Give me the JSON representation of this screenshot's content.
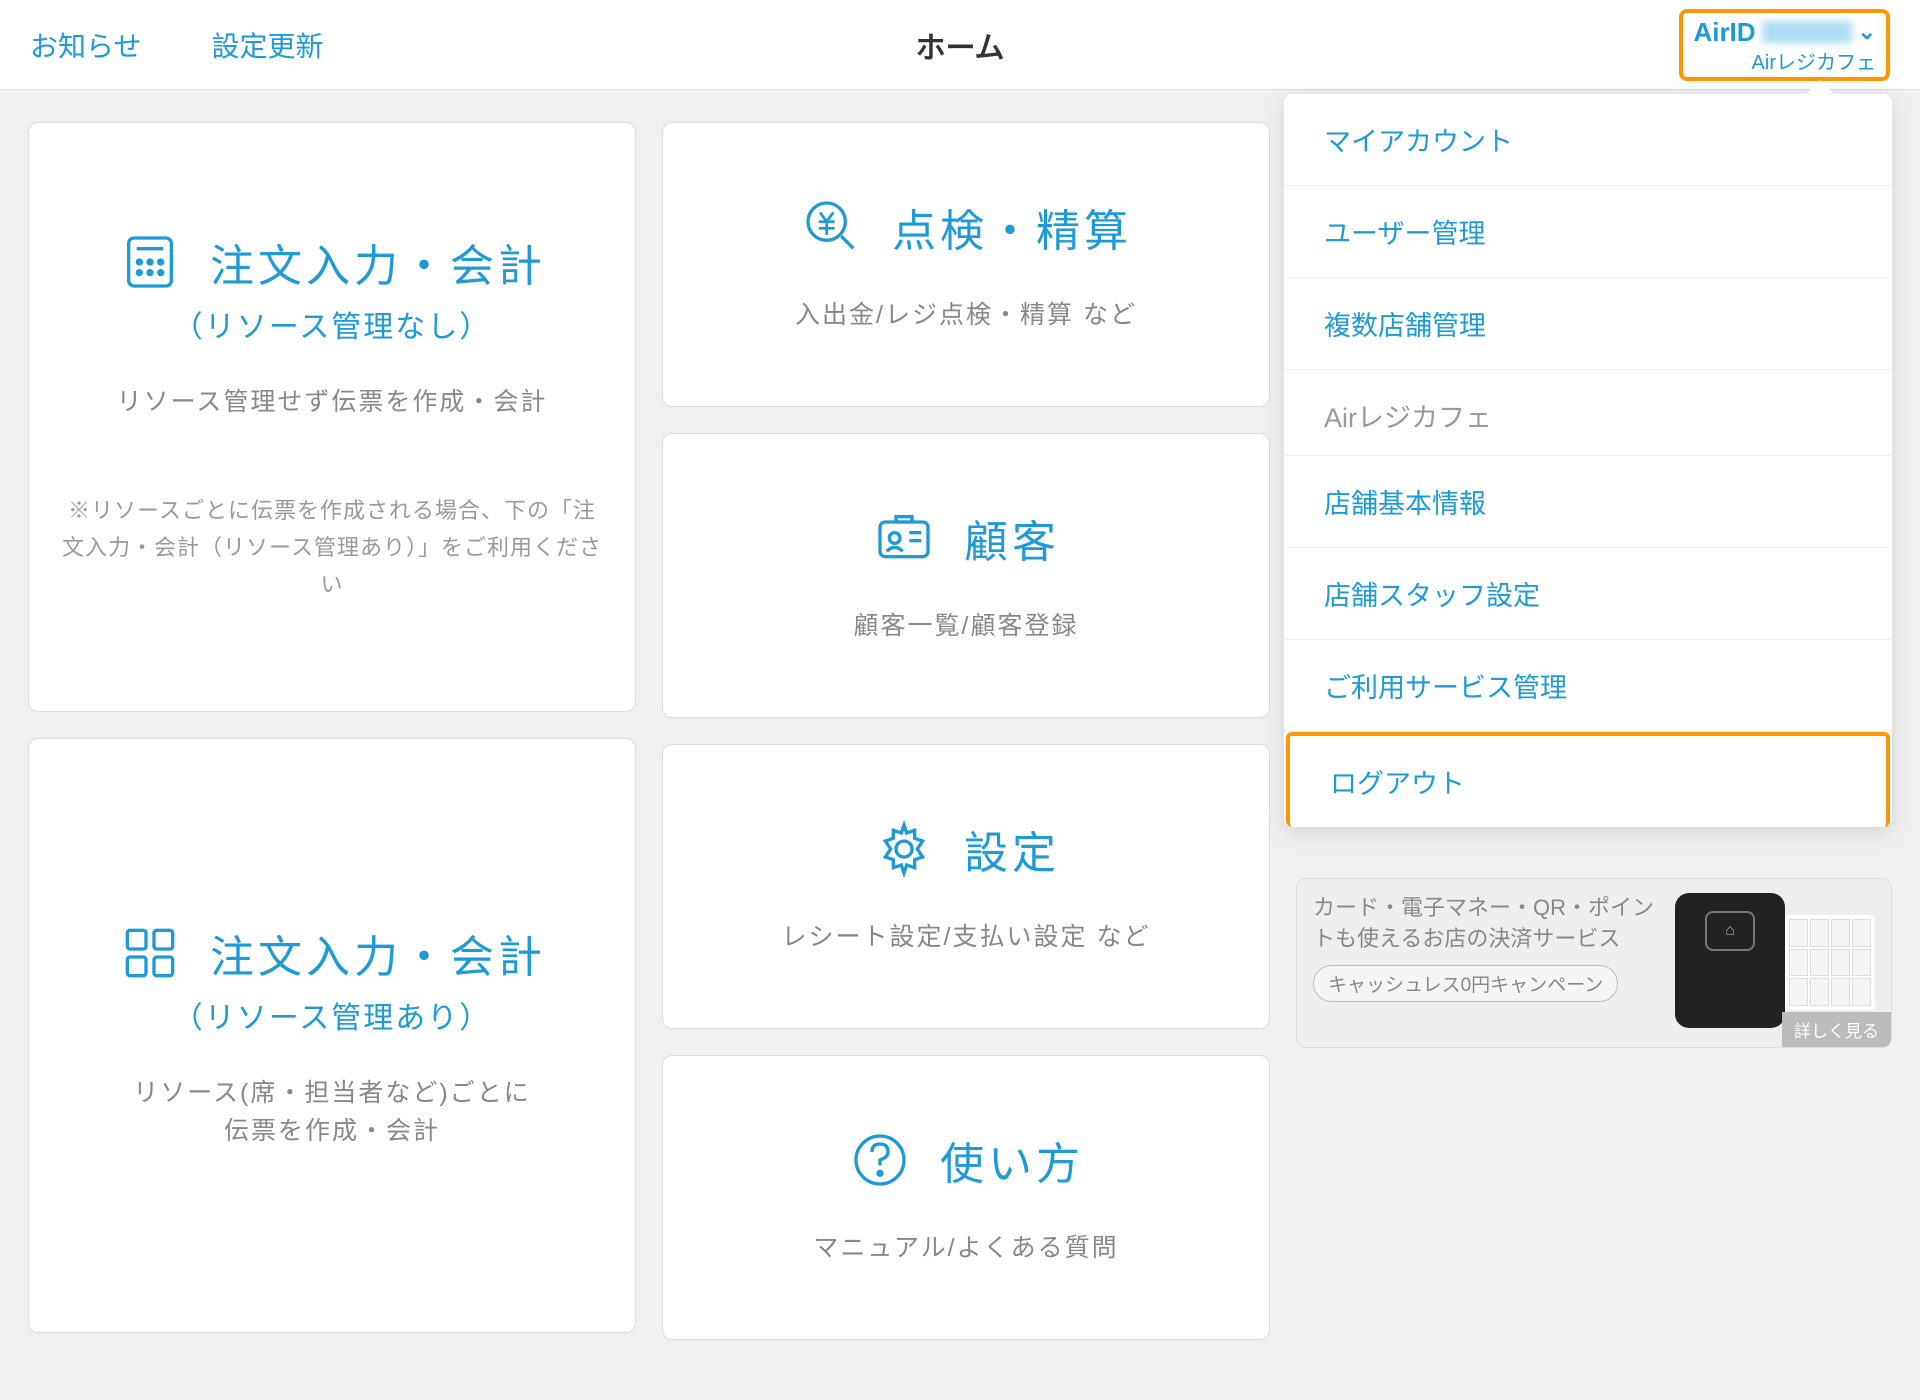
{
  "header": {
    "notice": "お知らせ",
    "settings_update": "設定更新",
    "title": "ホーム",
    "airid_label": "AirID",
    "store_sub": "Airレジカフェ"
  },
  "cards": {
    "order_noresource": {
      "title": "注文入力・会計",
      "subtitle": "（リソース管理なし）",
      "desc": "リソース管理せず伝票を作成・会計",
      "note": "※リソースごとに伝票を作成される場合、下の「注文入力・会計（リソース管理あり）」をご利用ください"
    },
    "order_resource": {
      "title": "注文入力・会計",
      "subtitle": "（リソース管理あり）",
      "desc": "リソース(席・担当者など)ごとに\n伝票を作成・会計"
    },
    "inspection": {
      "title": "点検・精算",
      "desc": "入出金/レジ点検・精算 など"
    },
    "customer": {
      "title": "顧客",
      "desc": "顧客一覧/顧客登録"
    },
    "settings": {
      "title": "設定",
      "desc": "レシート設定/支払い設定 など"
    },
    "howto": {
      "title": "使い方",
      "desc": "マニュアル/よくある質問"
    }
  },
  "promo": {
    "text": "カード・電子マネー・QR・ポイントも使えるお店の決済サービス",
    "badge": "キャッシュレス0円キャンペーン",
    "corner": "詳しく見る"
  },
  "dropdown": {
    "items_top": [
      "マイアカウント",
      "ユーザー管理",
      "複数店舗管理"
    ],
    "section": "Airレジカフェ",
    "items_store": [
      "店舗基本情報",
      "店舗スタッフ設定",
      "ご利用サービス管理"
    ],
    "logout": "ログアウト"
  }
}
